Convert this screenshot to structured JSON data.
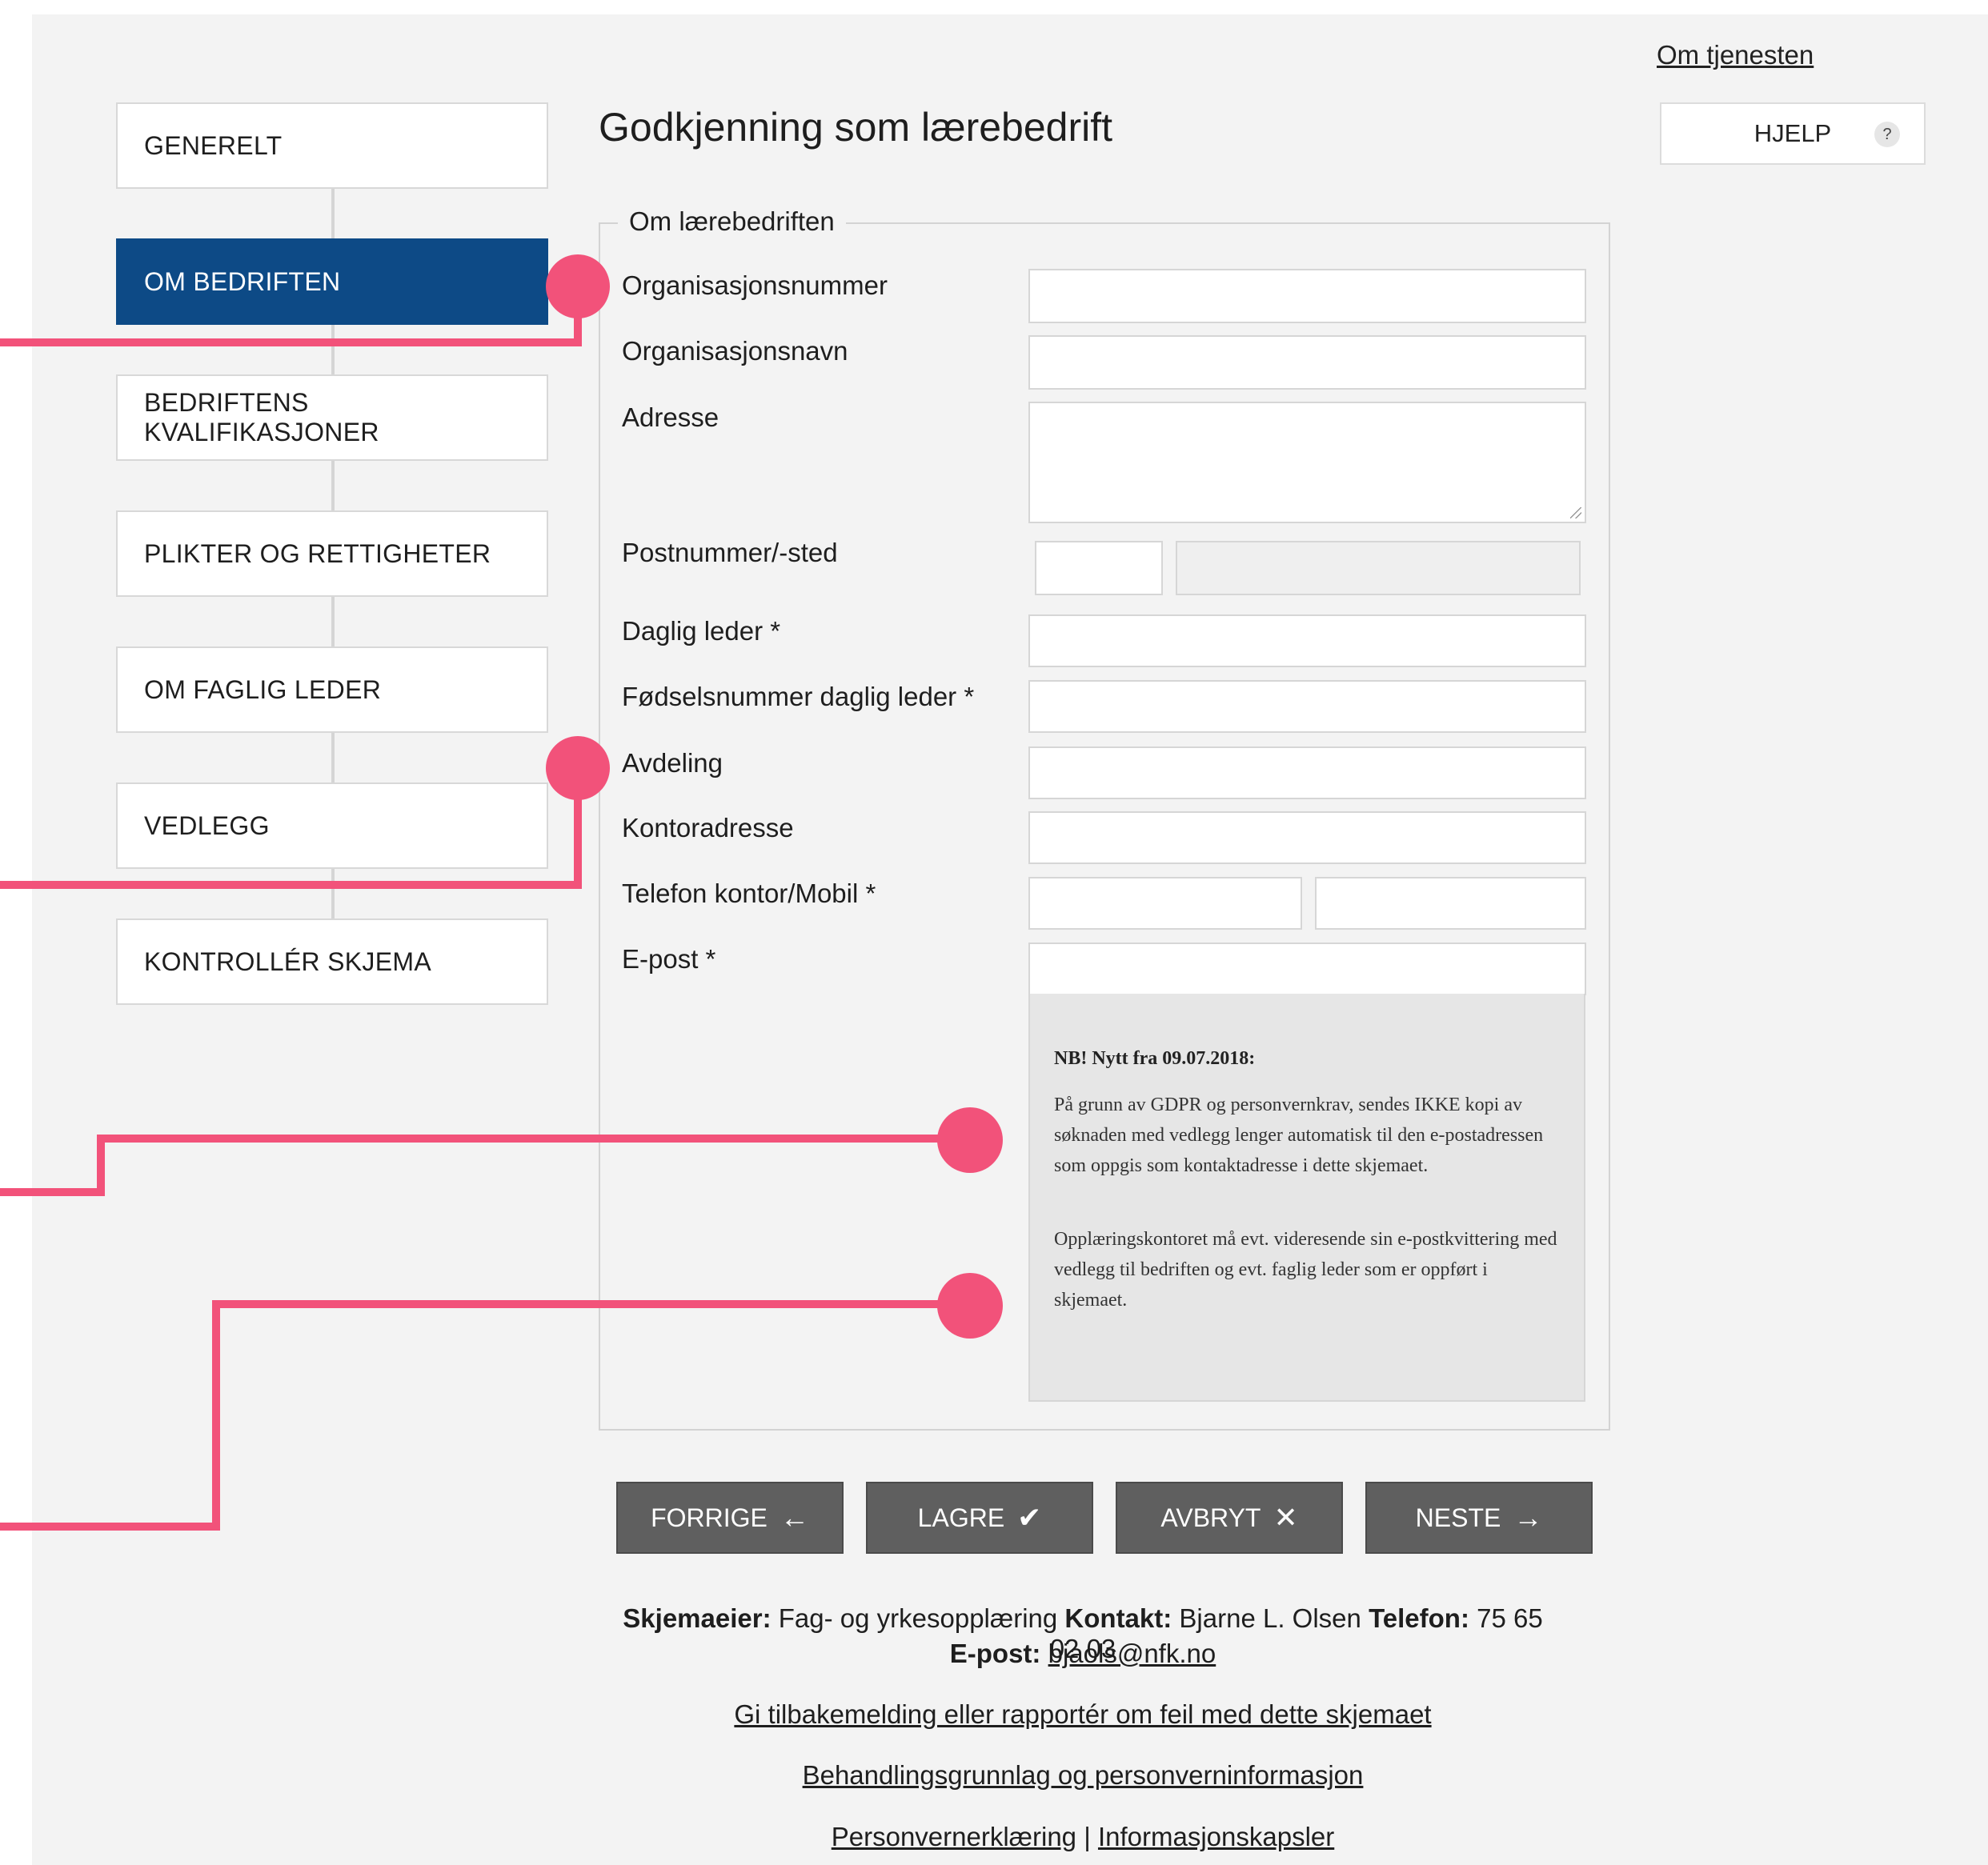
{
  "header": {
    "service_link": "Om tjenesten",
    "help_label": "HJELP",
    "help_icon": "?"
  },
  "sidebar": {
    "items": [
      {
        "label": "GENERELT",
        "active": false
      },
      {
        "label": "OM BEDRIFTEN",
        "active": true
      },
      {
        "label": "BEDRIFTENS KVALIFIKASJONER",
        "active": false
      },
      {
        "label": "PLIKTER OG RETTIGHETER",
        "active": false
      },
      {
        "label": "OM FAGLIG LEDER",
        "active": false
      },
      {
        "label": "VEDLEGG",
        "active": false
      },
      {
        "label": "KONTROLLÉR SKJEMA",
        "active": false
      }
    ]
  },
  "main": {
    "title": "Godkjenning som lærebedrift",
    "section_legend": "Om lærebedriften",
    "fields": {
      "org_number": "Organisasjonsnummer",
      "org_name": "Organisasjonsnavn",
      "address": "Adresse",
      "postal": "Postnummer/-sted",
      "manager": "Daglig leder *",
      "manager_id": "Fødselsnummer daglig leder *",
      "department": "Avdeling",
      "office_address": "Kontoradresse",
      "phone": "Telefon kontor/Mobil *",
      "email": "E-post *"
    },
    "notice": {
      "heading": "NB! Nytt fra 09.07.2018:",
      "paragraph1": "På grunn av GDPR og personvernkrav, sendes IKKE kopi av søknaden med vedlegg lenger automatisk til den e-postadressen som oppgis som kontaktadresse i dette skjemaet.",
      "paragraph2": "Opplæringskontoret må evt. videresende sin e-postkvittering med vedlegg til bedriften og evt. faglig leder som er oppført i skjemaet."
    }
  },
  "buttons": {
    "prev": "FORRIGE",
    "save": "LAGRE",
    "cancel": "AVBRYT",
    "next": "NESTE"
  },
  "footer": {
    "owner_label": "Skjemaeier:",
    "owner_value": "Fag- og yrkesopplæring",
    "contact_label": "Kontakt:",
    "contact_value": "Bjarne L. Olsen",
    "phone_label": "Telefon:",
    "phone_value": "75 65 02 03",
    "email_label": "E-post:",
    "email_value": "bjaols@nfk.no",
    "feedback_link": "Gi tilbakemelding eller rapportér om feil med dette skjemaet",
    "privacy_basis_link": "Behandlingsgrunnlag og personverninformasjon",
    "privacy_link": "Personvernerklæring",
    "separator": "|",
    "cookies_link": "Informasjonskapsler"
  },
  "colors": {
    "active_step": "#0d4a86",
    "button_bg": "#5f5f5f",
    "annotation": "#f2527a"
  }
}
